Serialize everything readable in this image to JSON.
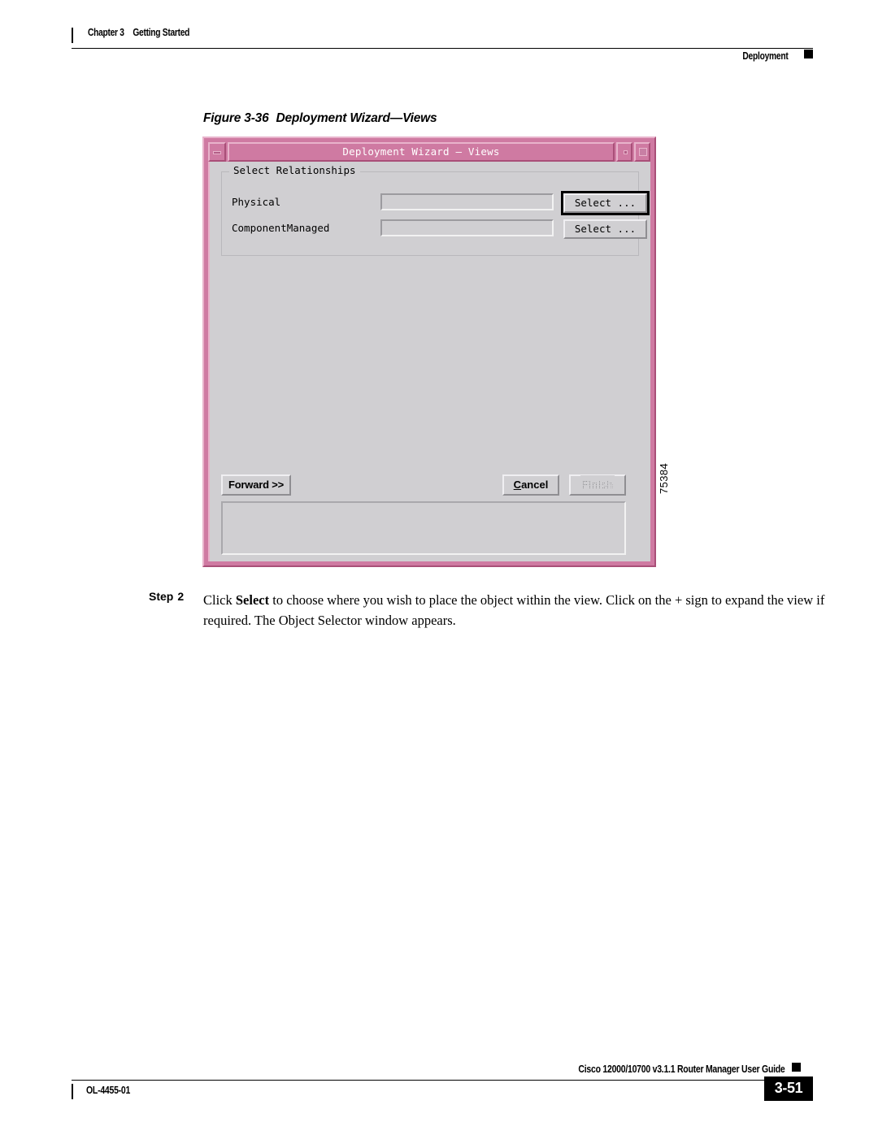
{
  "header": {
    "chapter": "Chapter 3",
    "chapter_title": "Getting Started",
    "section": "Deployment"
  },
  "figure": {
    "caption_number": "Figure 3-36",
    "caption_title": "Deployment Wizard—Views",
    "figure_id": "75384",
    "dialog": {
      "title": "Deployment Wizard — Views",
      "titlebar_buttons": {
        "window_menu": "window-menu",
        "minimize": "minimize",
        "maximize": "maximize"
      },
      "group_legend": "Select Relationships",
      "fields": [
        {
          "label": "Physical",
          "value": "",
          "button_label": "Select ...",
          "button_focused": true
        },
        {
          "label": "ComponentManaged",
          "value": "",
          "button_label": "Select ...",
          "button_focused": false
        }
      ],
      "buttons": {
        "forward": "Forward >>",
        "cancel_prefix": "C",
        "cancel_suffix": "ancel",
        "finish": "Finish"
      },
      "output_area": {
        "value": "",
        "scrollbar": "vertical"
      }
    }
  },
  "step": {
    "label": "Step",
    "number": "2",
    "text_part1": "Click ",
    "text_bold": "Select",
    "text_part2": " to choose where you wish to place the object within the view. Click on the + sign to expand the view if required. The Object Selector window appears."
  },
  "footer": {
    "guide_title": "Cisco 12000/10700 v3.1.1 Router Manager User Guide",
    "doc_id": "OL-4455-01",
    "page_number": "3-51"
  },
  "colors": {
    "titlebar": "#cf7aa2",
    "frame": "#cf7aa2",
    "dialog_bg": "#d0cfd2",
    "page_box": "#000000"
  }
}
